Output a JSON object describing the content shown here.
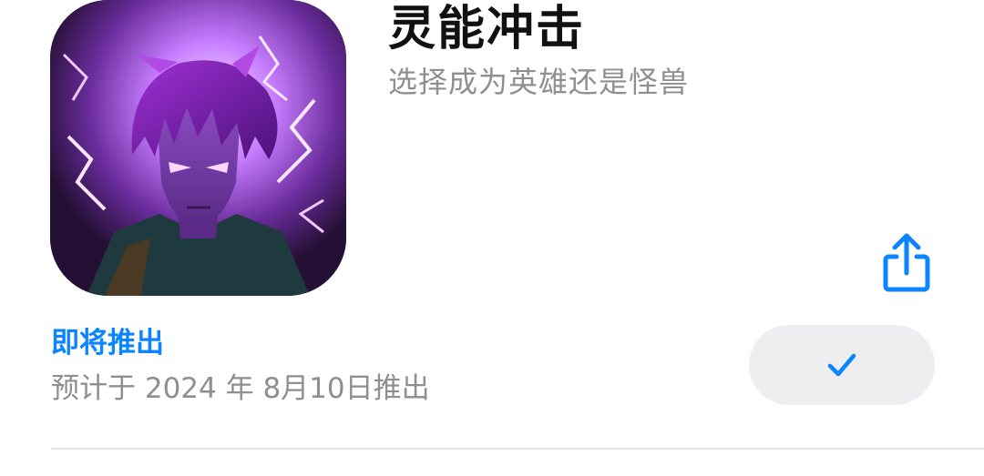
{
  "app": {
    "title": "灵能冲击",
    "subtitle": "选择成为英雄还是怪兽",
    "icon": "anime-hero-purple-lightning-icon"
  },
  "release": {
    "status": "即将推出",
    "date_text": "预计于 2024 年 8月10日推出"
  },
  "actions": {
    "share_icon": "share-icon",
    "notify_icon": "checkmark-icon"
  },
  "colors": {
    "accent": "#0a84ff",
    "secondary_text": "#8e8e93",
    "button_bg": "#eeeef0",
    "divider": "#e2e2e6"
  }
}
